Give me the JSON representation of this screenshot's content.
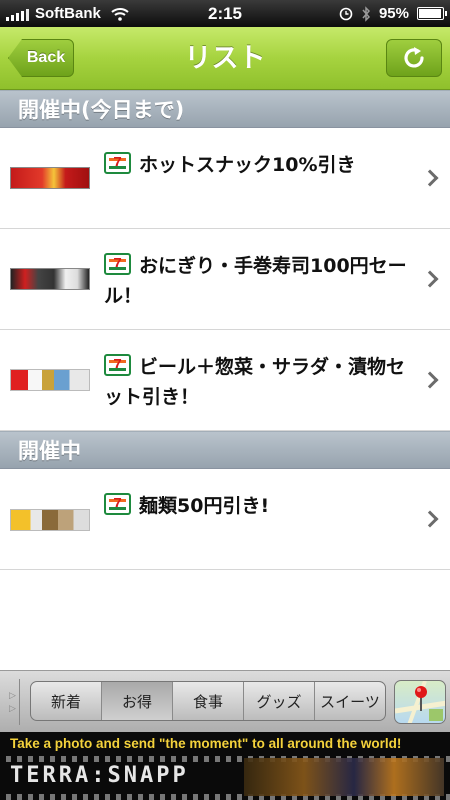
{
  "status_bar": {
    "carrier": "SoftBank",
    "time": "2:15",
    "battery": "95%",
    "battery_level": 0.95
  },
  "nav": {
    "back_label": "Back",
    "title": "リスト"
  },
  "sections": [
    {
      "title": "開催中(今日まで)"
    },
    {
      "title": "開催中"
    }
  ],
  "items": [
    {
      "brand_badge": "7",
      "text": "ホットスナック10%引き"
    },
    {
      "brand_badge": "7",
      "text": "おにぎり・手巻寿司100円セール！"
    },
    {
      "brand_badge": "7",
      "text": "ビール＋惣菜・サラダ・漬物セット引き！"
    },
    {
      "brand_badge": "7",
      "text": "麺類50円引き!"
    }
  ],
  "tabs": {
    "items": [
      "新着",
      "お得",
      "食事",
      "グッズ",
      "スイーツ"
    ],
    "selected": "お得"
  },
  "ad": {
    "tagline": "Take a photo and send  \"the moment\" to all around the world!",
    "brand": "TERRA:SNAPP"
  },
  "colors": {
    "nav_green": "#a6d33f",
    "section_gray": "#97a3ae",
    "ad_yellow": "#f4d23c"
  }
}
